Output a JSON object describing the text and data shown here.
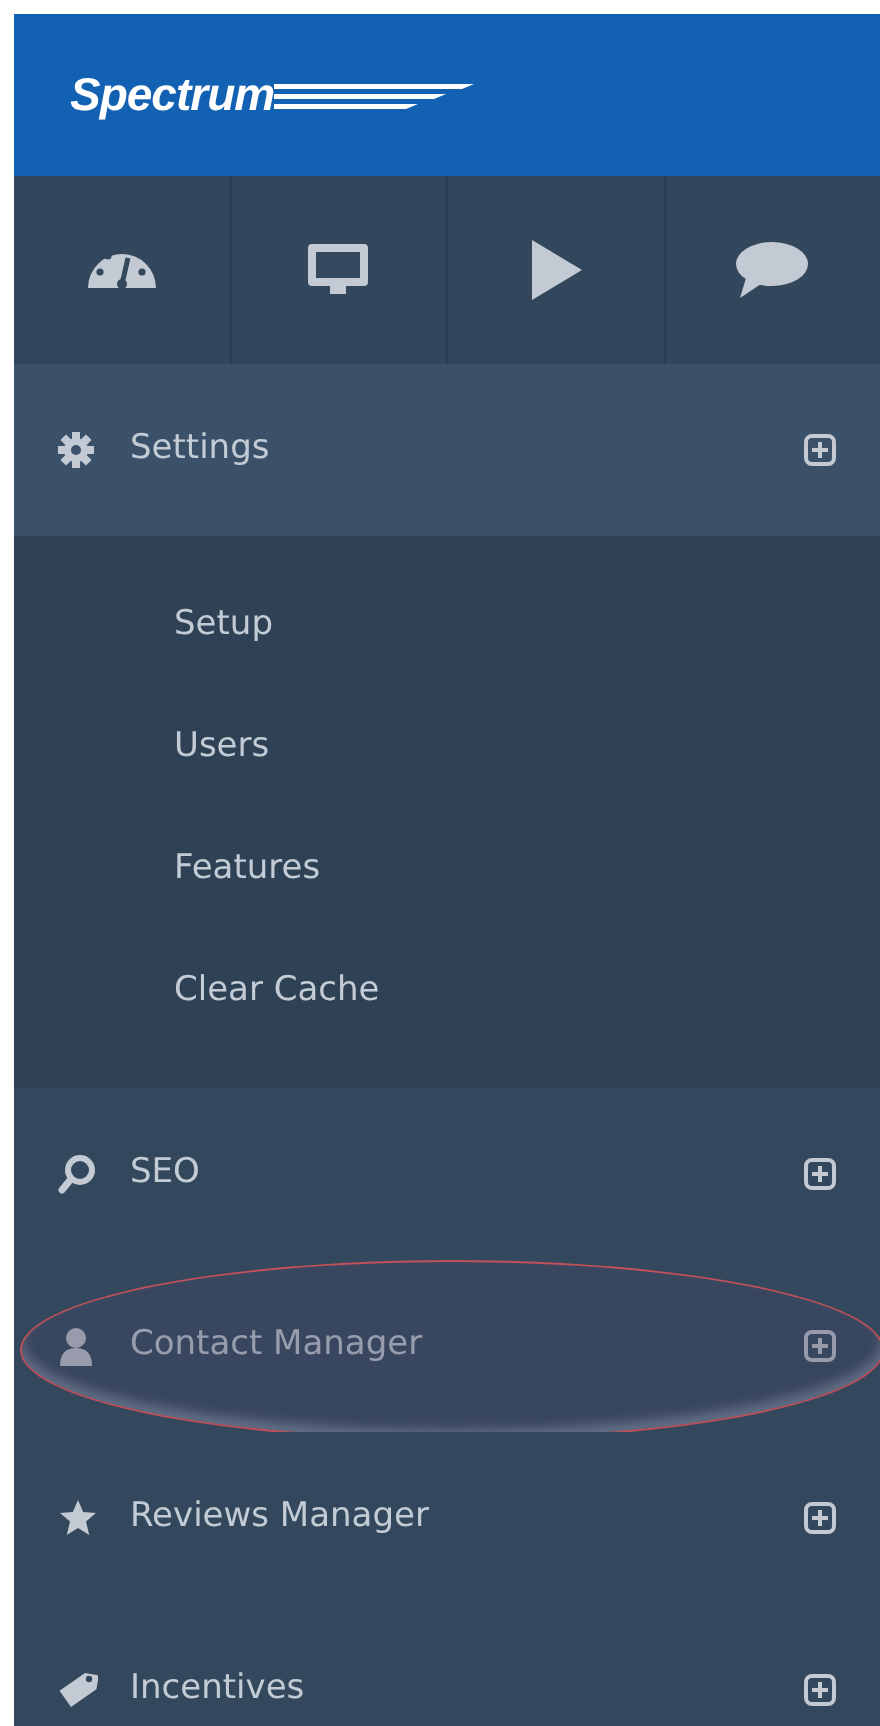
{
  "brand": {
    "name": "Spectrum"
  },
  "quick_icons": [
    {
      "kind": "gauge"
    },
    {
      "kind": "monitor"
    },
    {
      "kind": "play"
    },
    {
      "kind": "chat"
    }
  ],
  "menu": [
    {
      "kind": "gear",
      "label": "Settings",
      "expanded": true,
      "highlighted": false,
      "children": [
        {
          "label": "Setup"
        },
        {
          "label": "Users"
        },
        {
          "label": "Features"
        },
        {
          "label": "Clear Cache"
        }
      ]
    },
    {
      "kind": "search",
      "label": "SEO",
      "expanded": false,
      "highlighted": false
    },
    {
      "kind": "person",
      "label": "Contact Manager",
      "expanded": false,
      "highlighted": true
    },
    {
      "kind": "star",
      "label": "Reviews Manager",
      "expanded": false,
      "highlighted": false
    },
    {
      "kind": "tag",
      "label": "Incentives",
      "expanded": false,
      "highlighted": false
    }
  ]
}
